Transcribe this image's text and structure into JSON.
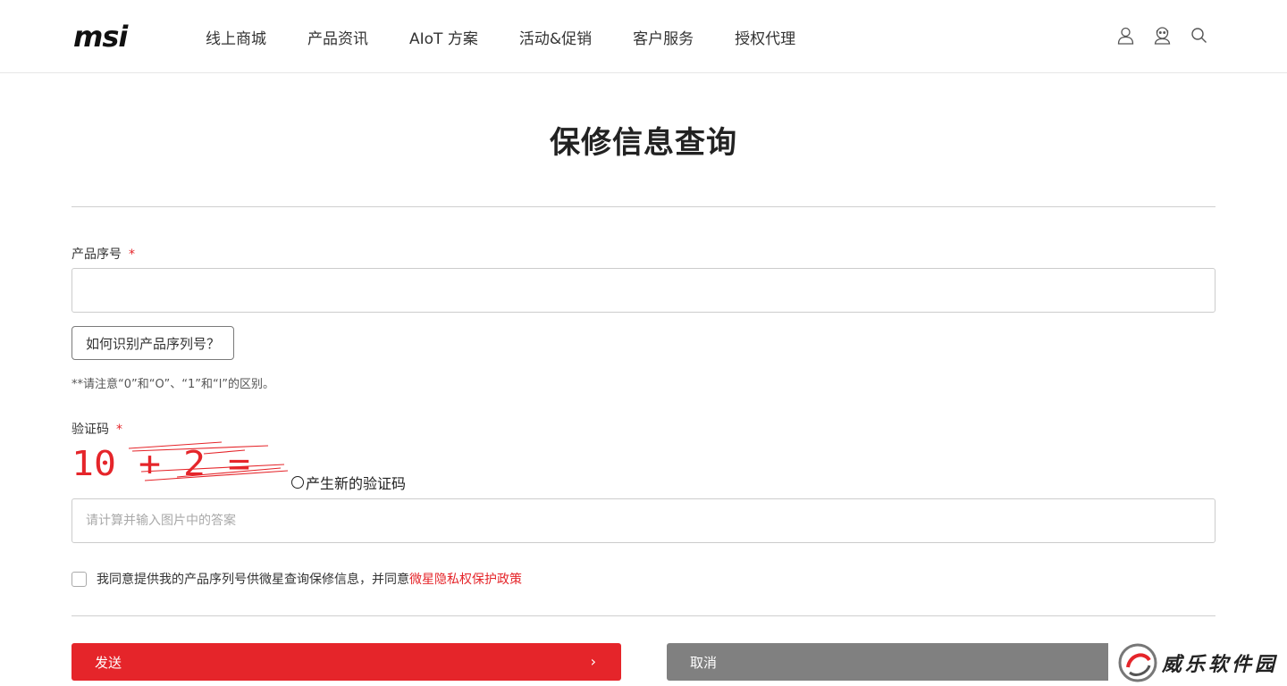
{
  "brand": {
    "logo_text": "msi"
  },
  "nav": {
    "items": [
      {
        "label": "线上商城"
      },
      {
        "label": "产品资讯"
      },
      {
        "label": "AIoT 方案"
      },
      {
        "label": "活动&促销"
      },
      {
        "label": "客户服务"
      },
      {
        "label": "授权代理"
      }
    ]
  },
  "header_icons": [
    "user-icon",
    "support-icon",
    "search-icon"
  ],
  "page": {
    "title": "保修信息查询"
  },
  "form": {
    "serial": {
      "label": "产品序号",
      "required_mark": "*",
      "value": "",
      "placeholder": ""
    },
    "help_button": "如何识别产品序列号？",
    "note": "**请注意“0”和“O”、“1”和“l”的区别。",
    "captcha": {
      "label": "验证码",
      "required_mark": "*",
      "image_text": "10 + 2 =",
      "refresh_label": "产生新的验证码",
      "placeholder": "请计算并输入图片中的答案",
      "value": ""
    },
    "consent": {
      "checked": false,
      "text": "我同意提供我的产品序列号供微星查询保修信息，并同意",
      "link_text": "微星隐私权保护政策"
    },
    "buttons": {
      "send": "发送",
      "cancel": "取消"
    }
  },
  "watermark": {
    "text": "威乐软件园"
  },
  "colors": {
    "accent": "#e5252a",
    "cancel_gray": "#808080",
    "border": "#cccccc"
  }
}
